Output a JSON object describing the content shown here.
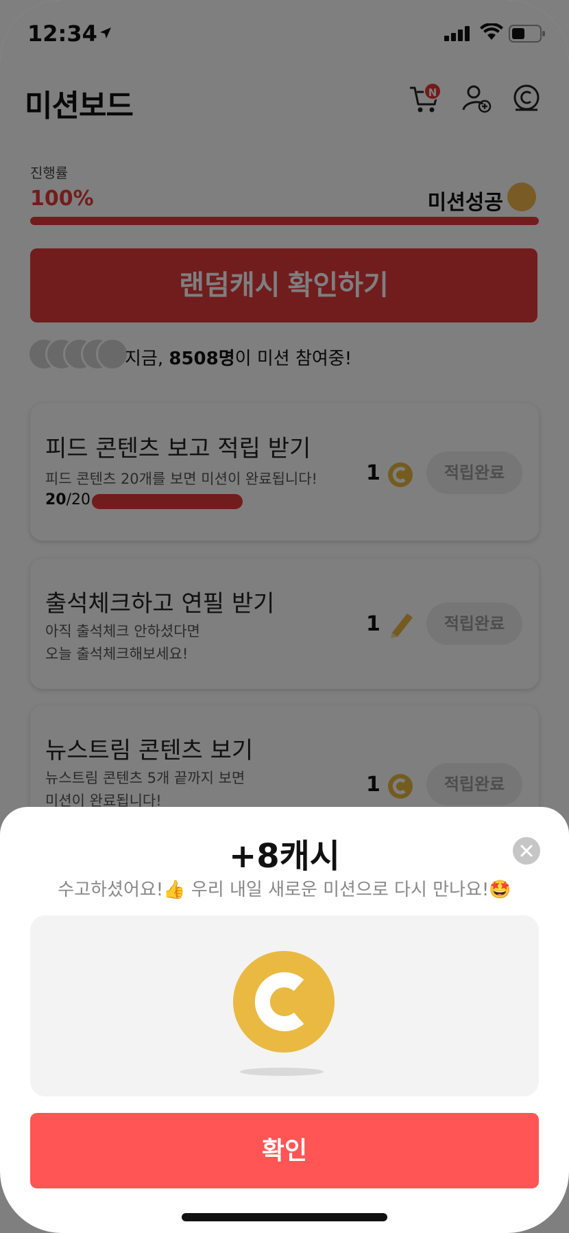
{
  "status": {
    "time": "12:34"
  },
  "header": {
    "title": "미션보드",
    "cart_badge": "N"
  },
  "progress": {
    "label": "진행률",
    "percent_text": "100%",
    "success_text": "미션성공",
    "fill_fraction": 1.0
  },
  "random_button": "랜덤캐시 확인하기",
  "participants": {
    "prefix": "지금, ",
    "count": "8508명",
    "suffix": "이 미션 참여중!"
  },
  "missions": [
    {
      "title": "피드 콘텐츠 보고 적립 받기",
      "desc1": "피드 콘텐츠 20개를 보면 미션이 완료됩니다!",
      "desc2": "",
      "reward": "1",
      "reward_icon": "coin-icon",
      "count_done": "20",
      "count_total": "/20",
      "button": "적립완료"
    },
    {
      "title": "출석체크하고 연필 받기",
      "desc1": "아직 출석체크 안하셨다면",
      "desc2": "오늘 출석체크해보세요!",
      "reward": "1",
      "reward_icon": "pencil-icon",
      "button": "적립완료"
    },
    {
      "title": "뉴스트림 콘텐츠 보기",
      "desc1": "뉴스트림 콘텐츠 5개 끝까지 보면",
      "desc2": "미션이 완료됩니다!",
      "reward": "1",
      "reward_icon": "coin-icon",
      "button": "적립완료"
    }
  ],
  "sheet": {
    "title": "+8캐시",
    "message_part1": "수고하셨어요!",
    "message_part2": " 우리 내일 새로운 미션으로 다시 만나요!",
    "confirm": "확인"
  },
  "colors": {
    "accent": "#e53b3b",
    "confirm": "#ff5555",
    "coin": "#e9b941"
  }
}
